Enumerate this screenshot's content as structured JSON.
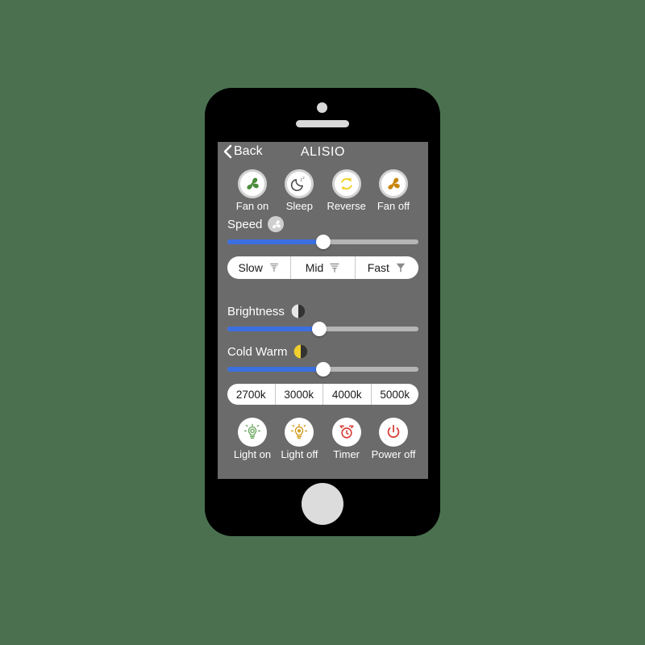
{
  "theme": {
    "page_background": "#4a7050",
    "phone_body": "#000000",
    "screen_background": "#6b6b6b",
    "accent_slider": "#3b6fe0",
    "slider_track": "#b5b5b5",
    "fan_on_color": "#4a8c3a",
    "fan_off_color": "#c8860d",
    "reverse_color": "#f2cf1f",
    "sleep_color": "#4c4c4c",
    "light_on_color": "#6fa862",
    "light_off_color": "#d39a1e",
    "timer_color": "#d63a32",
    "power_off_color": "#d63a32",
    "cold_warm_color": "#f0cf2e",
    "text_on_screen": "#ffffff"
  },
  "phone": {
    "camera_icon": "camera-dot",
    "speaker_icon": "speaker-grill",
    "home_button_icon": "home-button"
  },
  "navbar": {
    "back_icon": "chevron-left-icon",
    "back_label": "Back",
    "title": "ALISIO"
  },
  "fan_controls": {
    "buttons": [
      {
        "label": "Fan on",
        "icon": "fan-icon",
        "color": "#4a8c3a"
      },
      {
        "label": "Sleep",
        "icon": "moon-sleep-icon",
        "color": "#4c4c4c"
      },
      {
        "label": "Reverse",
        "icon": "refresh-reverse-icon",
        "color": "#f2cf1f"
      },
      {
        "label": "Fan off",
        "icon": "fan-icon",
        "color": "#c8860d"
      }
    ]
  },
  "speed": {
    "label": "Speed",
    "badge_icon": "fan-badge-icon",
    "value_percent": 50,
    "slider_name": "speed-slider"
  },
  "speed_presets": {
    "options": [
      {
        "label": "Slow",
        "icon": "wind-slow-icon"
      },
      {
        "label": "Mid",
        "icon": "wind-mid-icon"
      },
      {
        "label": "Fast",
        "icon": "wind-fast-icon"
      }
    ]
  },
  "brightness": {
    "label": "Brightness",
    "badge_icon": "half-circle-brightness-icon",
    "value_percent": 48,
    "slider_name": "brightness-slider"
  },
  "cold_warm": {
    "label": "Cold Warm",
    "badge_icon": "half-circle-warm-icon",
    "value_percent": 50,
    "slider_name": "cold-warm-slider"
  },
  "color_temperature": {
    "options": [
      {
        "label": "2700k"
      },
      {
        "label": "3000k"
      },
      {
        "label": "4000k"
      },
      {
        "label": "5000k"
      }
    ]
  },
  "light_controls": {
    "buttons": [
      {
        "label": "Light on",
        "icon": "bulb-on-icon",
        "color": "#6fa862"
      },
      {
        "label": "Light off",
        "icon": "bulb-off-icon",
        "color": "#d39a1e"
      },
      {
        "label": "Timer",
        "icon": "alarm-clock-icon",
        "color": "#d63a32"
      },
      {
        "label": "Power off",
        "icon": "power-icon",
        "color": "#d63a32"
      }
    ]
  }
}
